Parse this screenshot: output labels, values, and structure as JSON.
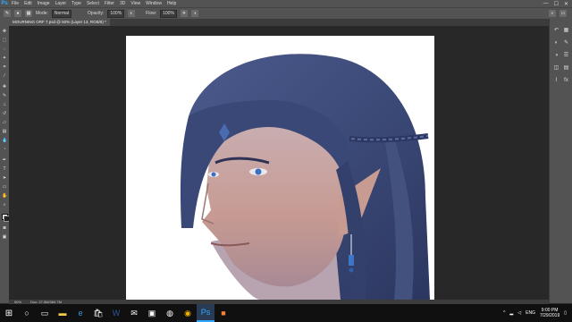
{
  "app": {
    "logo": "Ps"
  },
  "menu": [
    "File",
    "Edit",
    "Image",
    "Layer",
    "Type",
    "Select",
    "Filter",
    "3D",
    "View",
    "Window",
    "Help"
  ],
  "window_controls": {
    "minimize": "—",
    "maximize": "☐",
    "close": "✕"
  },
  "options": {
    "mode_label": "Mode:",
    "mode_value": "Normal",
    "opacity_label": "Opacity:",
    "opacity_value": "100%",
    "flow_label": "Flow:",
    "flow_value": "100%"
  },
  "document_tab": "MOURNING ORF 7.psd @ 50% (Layer 13, RGB/8) *",
  "status": {
    "zoom": "50%",
    "doc_size": "Doc: 27.5M/360.7M"
  },
  "taskbar": {
    "start_icon": "windows-icon",
    "language": "ENG",
    "time": "9:00 PM",
    "date": "7/29/2019"
  },
  "colors": {
    "ui_bg": "#535353",
    "pasteboard": "#282828",
    "accent": "#31a8ff",
    "hair": "#3c4a78"
  }
}
